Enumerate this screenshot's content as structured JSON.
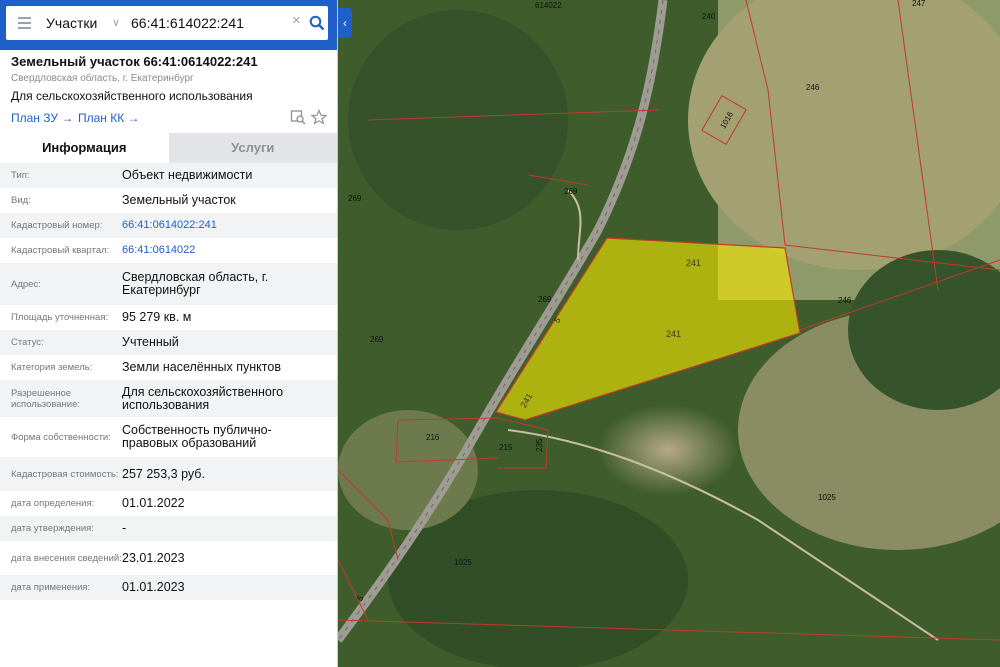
{
  "search": {
    "layer": "Участки",
    "value": "66:41:614022:241"
  },
  "header": {
    "title": "Земельный участок 66:41:0614022:241",
    "subtitle": "Свердловская область, г. Екатеринбург",
    "usage": "Для сельскохозяйственного использования",
    "plan_zu": "План ЗУ →",
    "plan_kk": "План КК →"
  },
  "tabs": [
    {
      "label": "Информация",
      "active": true
    },
    {
      "label": "Услуги",
      "active": false
    }
  ],
  "rows": [
    {
      "label": "Тип:",
      "value": "Объект недвижимости"
    },
    {
      "label": "Вид:",
      "value": "Земельный участок"
    },
    {
      "label": "Кадастровый номер:",
      "value": "66:41:0614022:241",
      "link": true
    },
    {
      "label": "Кадастровый квартал:",
      "value": "66:41:0614022",
      "link": true
    },
    {
      "label": "Адрес:",
      "value": "Свердловская область, г. Екатеринбург"
    },
    {
      "label": "Площадь уточненная:",
      "value": "95 279 кв. м"
    },
    {
      "label": "Статус:",
      "value": "Учтенный"
    },
    {
      "label": "Категория земель:",
      "value": "Земли населённых пунктов"
    },
    {
      "label": "Разрешенное использование:",
      "value": "Для сельскохозяйственного использования"
    },
    {
      "label": "Форма собственности:",
      "value": "Собственность публично-правовых образований"
    },
    {
      "label": "Кадастровая стоимость:",
      "value": "257 253,3 руб."
    },
    {
      "label": "дата определения:",
      "value": "01.01.2022"
    },
    {
      "label": "дата утверждения:",
      "value": "-"
    },
    {
      "label": "дата внесения сведений:",
      "value": "23.01.2023"
    },
    {
      "label": "дата применения:",
      "value": "01.01.2023"
    }
  ],
  "map": {
    "parcel_color": "#f2e600",
    "boundary_color": "#c23a2a",
    "labels": {
      "l614022": "614022",
      "l240": "240",
      "l247": "247",
      "l246a": "246",
      "l1016": "1016",
      "l269a": "269",
      "l269b": "269",
      "l269c": "269",
      "l269d": "269",
      "l241a": "241",
      "l241b": "241",
      "l241c": "241",
      "l246b": "246",
      "l216": "216",
      "l215": "215",
      "l235": "235",
      "l1025a": "1025",
      "l1025b": "1025",
      "l5a": "5",
      "l5b": "5"
    }
  },
  "icons": [
    "menu-icon",
    "search-icon",
    "clear-icon",
    "chevron-left-icon",
    "map-search-icon",
    "star-icon"
  ],
  "colors": {
    "header_blue": "#1f5fc7",
    "link_blue": "#1f5fc7"
  }
}
